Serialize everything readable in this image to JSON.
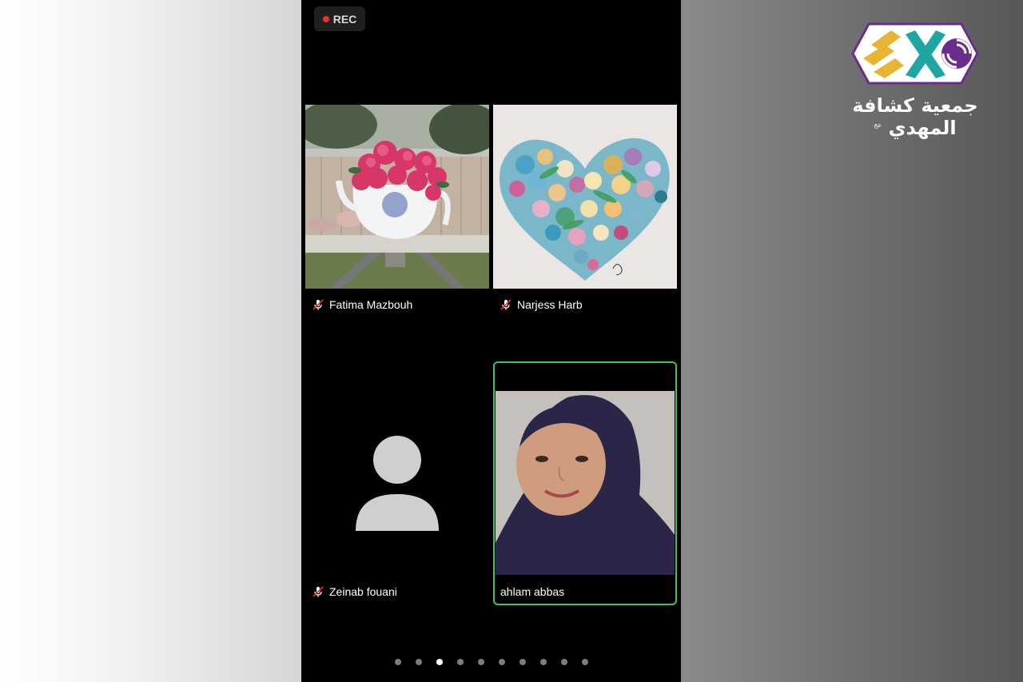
{
  "recording": {
    "label": "REC",
    "dot_color": "#e3342f"
  },
  "participants": [
    {
      "name": "Fatima Mazbouh",
      "muted": true,
      "media": "flowers-teapot-photo"
    },
    {
      "name": "Narjess Harb",
      "muted": true,
      "media": "quilled-heart-photo"
    },
    {
      "name": "Zeinab fouani",
      "muted": true,
      "media": "default-avatar"
    },
    {
      "name": "ahlam abbas",
      "muted": false,
      "media": "camera-video",
      "active_speaker": true
    }
  ],
  "pagination": {
    "total": 10,
    "current": 3
  },
  "branding": {
    "org_name": "جمعية كشافة المهدي",
    "honorific": "عج",
    "logo_colors": [
      "#6b2c8f",
      "#e6b632",
      "#1ea7a2",
      "#ffffff"
    ]
  },
  "colors": {
    "active_border": "#3cc35a"
  }
}
